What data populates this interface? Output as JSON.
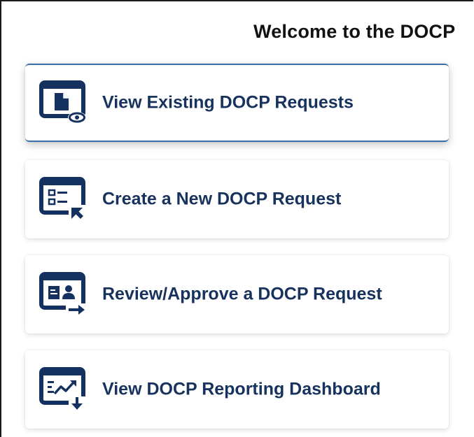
{
  "header": {
    "title": "Welcome to the DOCP"
  },
  "menu": {
    "items": [
      {
        "label": "View Existing DOCP Requests",
        "icon": "document-view-icon",
        "active": true
      },
      {
        "label": "Create a New DOCP Request",
        "icon": "form-cursor-icon",
        "active": false
      },
      {
        "label": "Review/Approve a DOCP Request",
        "icon": "contact-card-arrow-icon",
        "active": false
      },
      {
        "label": "View DOCP Reporting Dashboard",
        "icon": "chart-download-icon",
        "active": false
      }
    ]
  },
  "colors": {
    "icon_navy": "#14315f",
    "label_navy": "#17325c",
    "active_border": "#3a6ea8"
  }
}
